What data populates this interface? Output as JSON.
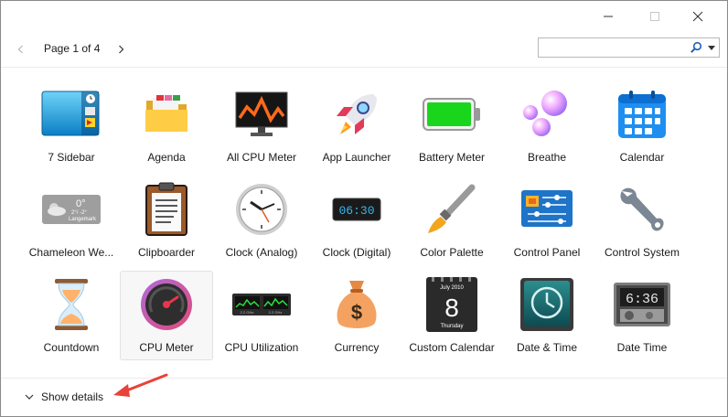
{
  "window": {
    "controls": [
      {
        "name": "minimize-button",
        "icon": "minimize-icon"
      },
      {
        "name": "maximize-button",
        "icon": "maximize-icon"
      },
      {
        "name": "close-button",
        "icon": "close-icon"
      }
    ]
  },
  "nav": {
    "page_label": "Page 1 of 4",
    "search": {
      "value": "",
      "placeholder": ""
    },
    "prev_icon": "chevron-left-icon",
    "next_icon": "chevron-right-icon"
  },
  "gadgets": [
    {
      "label": "7 Sidebar",
      "icon": "sidebar-icon"
    },
    {
      "label": "Agenda",
      "icon": "folder-icon"
    },
    {
      "label": "All CPU Meter",
      "icon": "monitor-graph-icon"
    },
    {
      "label": "App Launcher",
      "icon": "rocket-icon"
    },
    {
      "label": "Battery Meter",
      "icon": "battery-icon"
    },
    {
      "label": "Breathe",
      "icon": "bubbles-icon"
    },
    {
      "label": "Calendar",
      "icon": "calendar-icon"
    },
    {
      "label": "Chameleon We...",
      "icon": "weather-icon",
      "sub": {
        "temp": "0°",
        "range": "2°/ -2°",
        "city": "Langemark"
      }
    },
    {
      "label": "Clipboarder",
      "icon": "clipboard-icon"
    },
    {
      "label": "Clock (Analog)",
      "icon": "analog-clock-icon"
    },
    {
      "label": "Clock (Digital)",
      "icon": "digital-clock-icon",
      "sub": {
        "time": "06:30"
      }
    },
    {
      "label": "Color Palette",
      "icon": "paintbrush-icon"
    },
    {
      "label": "Control Panel",
      "icon": "control-panel-icon"
    },
    {
      "label": "Control System",
      "icon": "wrench-icon"
    },
    {
      "label": "Countdown",
      "icon": "hourglass-icon"
    },
    {
      "label": "CPU Meter",
      "icon": "gauge-icon",
      "selected": true
    },
    {
      "label": "CPU Utilization",
      "icon": "cpu-graph-icon",
      "sub": {
        "freq1": "2.2 GHz",
        "freq2": "2.2 GHz"
      }
    },
    {
      "label": "Currency",
      "icon": "money-bag-icon"
    },
    {
      "label": "Custom Calendar",
      "icon": "desk-calendar-icon",
      "sub": {
        "month": "July 2010",
        "day": "8",
        "weekday": "Thursday"
      }
    },
    {
      "label": "Date & Time",
      "icon": "teal-clock-icon"
    },
    {
      "label": "Date Time",
      "icon": "lcd-clock-icon",
      "sub": {
        "time": "6:36"
      }
    }
  ],
  "footer": {
    "details_label": "Show details",
    "details_icon": "chevron-down-icon"
  },
  "colors": {
    "accent": "#0067c0",
    "annotation": "#e8423a",
    "text": "#1a1a1a"
  }
}
